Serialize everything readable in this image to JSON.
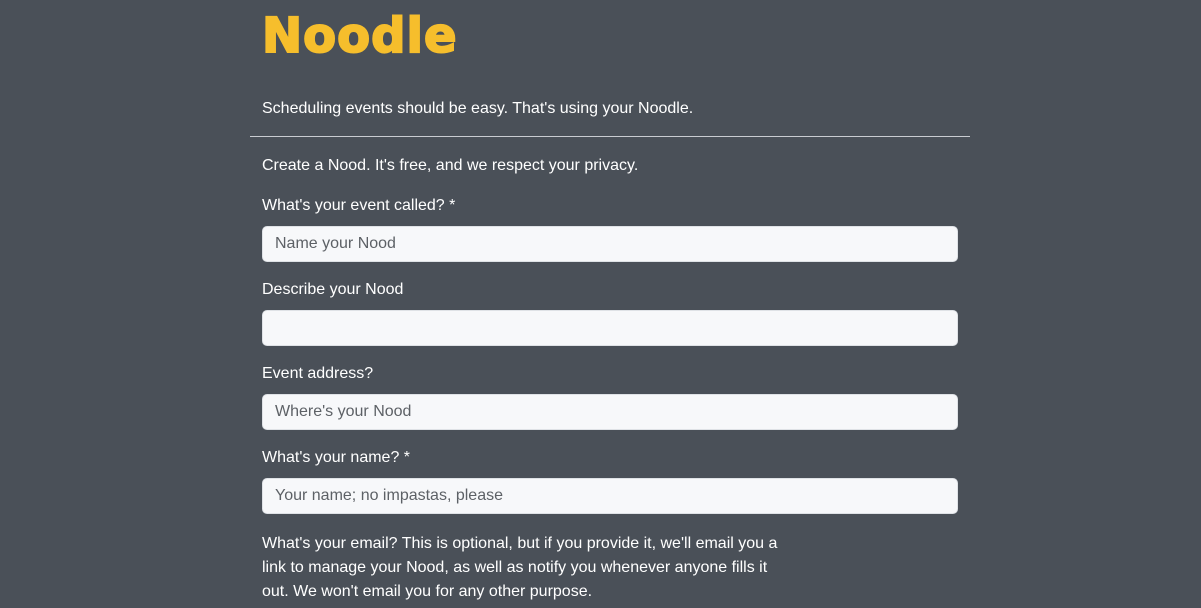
{
  "header": {
    "logo_text": "Noodle",
    "tagline": "Scheduling events should be easy. That's using your Noodle."
  },
  "form": {
    "intro": "Create a Nood. It's free, and we respect your privacy.",
    "event_name": {
      "label": "What's your event called? *",
      "placeholder": "Name your Nood",
      "value": ""
    },
    "description": {
      "label": "Describe your Nood",
      "placeholder": "",
      "value": ""
    },
    "address": {
      "label": "Event address?",
      "placeholder": "Where's your Nood",
      "value": ""
    },
    "your_name": {
      "label": "What's your name? *",
      "placeholder": "Your name; no impastas, please",
      "value": ""
    },
    "email_note": "What's your email? This is optional, but if you provide it, we'll email you a link to manage your Nood, as well as notify you whenever anyone fills it out. We won't email you for any other purpose."
  },
  "colors": {
    "background": "#4a5058",
    "logo": "#f6be2c",
    "input_background": "#f7f8fa",
    "divider": "#c9ccd1"
  }
}
